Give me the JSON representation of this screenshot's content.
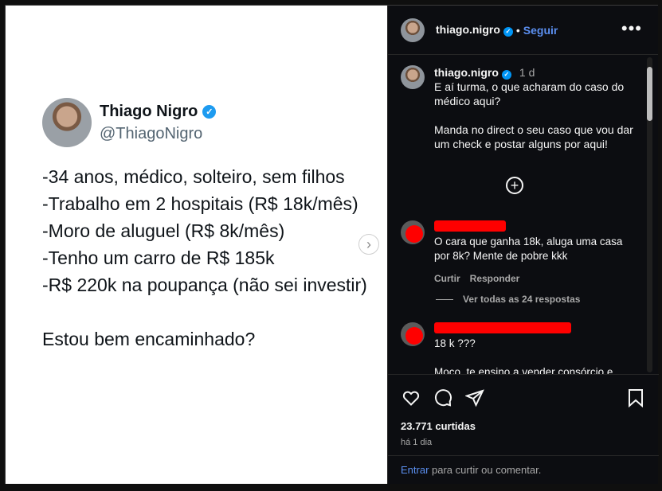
{
  "tweet": {
    "name": "Thiago Nigro",
    "handle": "@ThiagoNigro",
    "lines": [
      "-34 anos, médico, solteiro, sem filhos",
      "-Trabalho em 2 hospitais (R$ 18k/mês)",
      "-Moro de aluguel (R$ 8k/mês)",
      "-Tenho um carro de R$ 185k",
      "-R$ 220k na poupança (não sei investir)"
    ],
    "question": "Estou bem encaminhado?"
  },
  "header": {
    "username": "thiago.nigro",
    "separator": "•",
    "follow_label": "Seguir",
    "more_label": "•••"
  },
  "caption": {
    "username": "thiago.nigro",
    "time": "1 d",
    "text": "E aí turma, o que acharam do caso do médico aqui?\n\nManda no direct o seu caso que vou dar um check e postar alguns por aqui!"
  },
  "load_more_label": "+",
  "comments": [
    {
      "text": "O cara que ganha 18k, aluga uma casa por 8k? Mente de pobre kkk",
      "reply_label": "Curtir",
      "respond_label": "Responder",
      "view_replies": "Ver todas as 24 respostas"
    },
    {
      "text": "18 k ???\n\nMoço, te ensino a vender consórcio e"
    }
  ],
  "engagement": {
    "likes": "23.771 curtidas",
    "time_ago": "há 1 dia"
  },
  "footer": {
    "login_link": "Entrar",
    "rest": " para curtir ou comentar."
  },
  "colors": {
    "accent_blue": "#0095f6",
    "link_blue": "#5b8ff0",
    "panel_bg": "#0c0d11",
    "redaction": "#ff0000"
  }
}
